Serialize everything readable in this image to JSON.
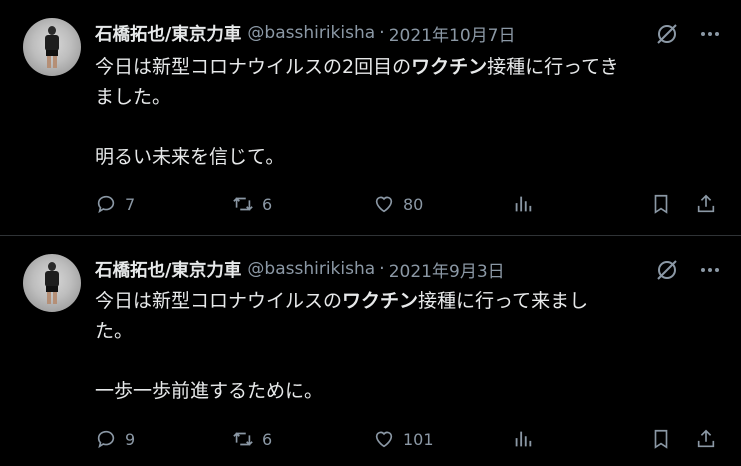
{
  "tweets": [
    {
      "author_name": "石橋拓也/東京力車",
      "handle": "@basshirikisha",
      "separator": "·",
      "date": "2021年10月7日",
      "text_part1": "今日は新型コロナウイルスの2回目の",
      "text_bold": "ワクチン",
      "text_part2": "接種に行ってき\nました。\n\n明るい未来を信じて。",
      "replies": "7",
      "retweets": "6",
      "likes": "80"
    },
    {
      "author_name": "石橋拓也/東京力車",
      "handle": "@basshirikisha",
      "separator": "·",
      "date": "2021年9月3日",
      "text_part1": "今日は新型コロナウイルスの",
      "text_bold": "ワクチン",
      "text_part2": "接種に行って来まし\nた。\n\n一歩一歩前進するために。",
      "replies": "9",
      "retweets": "6",
      "likes": "101"
    }
  ],
  "icons": {
    "reply": "reply-icon",
    "retweet": "retweet-icon",
    "like": "heart-icon",
    "views": "views-icon",
    "bookmark": "bookmark-icon",
    "share": "share-icon",
    "grok": "grok-icon",
    "more": "more-icon"
  },
  "colors": {
    "background": "#000000",
    "text": "#e7e9ea",
    "muted": "#8b98a5",
    "divider": "#2f3336"
  }
}
